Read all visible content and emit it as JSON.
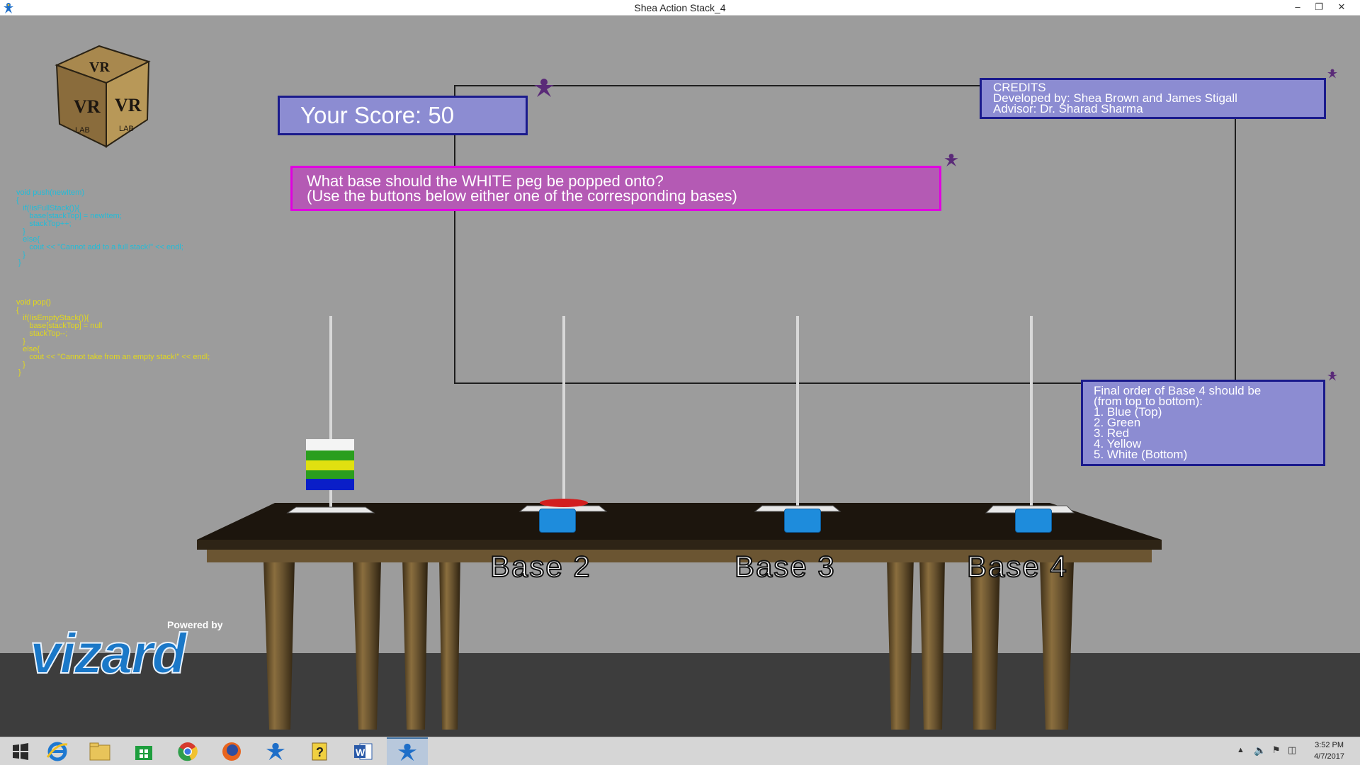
{
  "window": {
    "title": "Shea Action Stack_4"
  },
  "score": {
    "text": "Your Score: 50"
  },
  "question": {
    "line1": "What base should the WHITE peg be popped onto?",
    "line2": "(Use the buttons below either one of the corresponding bases)"
  },
  "credits": {
    "heading": "CREDITS",
    "developed": "Developed by: Shea Brown and James Stigall",
    "advisor": "Advisor: Dr. Sharad Sharma"
  },
  "order": {
    "line1": "Final order of Base 4 should be",
    "line2": "(from top to bottom):",
    "items": [
      "1. Blue (Top)",
      "2. Green",
      "3. Red",
      "4. Yellow",
      "5. White (Bottom)"
    ]
  },
  "code": {
    "push": "void push(newItem)\n{\n   if(!isFullStack()){\n      base[stackTop] = newItem;\n      stackTop++;\n   }\n   else{\n      cout << \"Cannot add to a full stack!\" << endl;\n   }\n }",
    "pop": "void pop()\n{\n   if(!isEmptyStack()){\n      base[stackTop] = null\n      stackTop--;\n   }\n   else{\n      cout << \"Cannot take from an empty stack!\" << endl;\n   }\n }"
  },
  "bases": [
    {
      "label": "Base 2"
    },
    {
      "label": "Base 3"
    },
    {
      "label": "Base 4"
    }
  ],
  "logo": {
    "lab_text": "VR LAB",
    "powered_by": "Powered by",
    "vizard": "vizard"
  },
  "stack_rings": [
    "white",
    "green",
    "yellow",
    "green",
    "blue"
  ],
  "colors": {
    "panel_blue": "#8c8cd2",
    "panel_magenta": "#b45ab4",
    "button_blue": "#1e8cdc",
    "ring_red": "#d21e1e"
  },
  "taskbar": {
    "items": [
      "start-icon",
      "internet-explorer-icon",
      "file-explorer-icon",
      "store-icon",
      "chrome-icon",
      "firefox-icon",
      "vizard-icon",
      "help-icon",
      "word-icon",
      "vizard-active-icon"
    ],
    "time": "3:52 PM",
    "date": "4/7/2017"
  }
}
